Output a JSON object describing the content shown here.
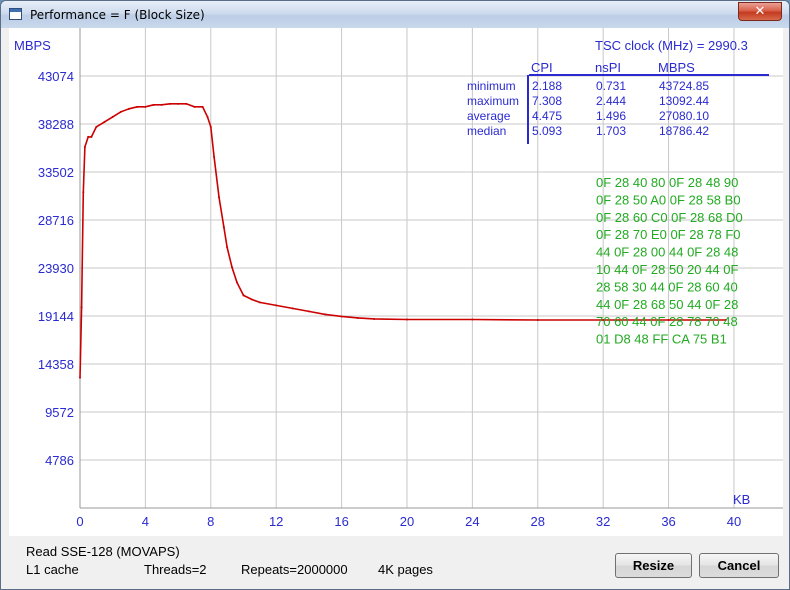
{
  "window": {
    "title": "Performance = F (Block Size)",
    "close_glyph": "✕"
  },
  "stats": {
    "tsc_label": "TSC clock (MHz)  = 2990.3",
    "headers": [
      "CPI",
      "nsPI",
      "MBPS"
    ],
    "rows": [
      {
        "label": "minimum",
        "cpi": "2.188",
        "nspi": "0.731",
        "mbps": "43724.85"
      },
      {
        "label": "maximum",
        "cpi": "7.308",
        "nspi": "2.444",
        "mbps": "13092.44"
      },
      {
        "label": "average",
        "cpi": "4.475",
        "nspi": "1.496",
        "mbps": "27080.10"
      },
      {
        "label": "median",
        "cpi": "5.093",
        "nspi": "1.703",
        "mbps": "18786.42"
      }
    ],
    "opcode_lines": [
      "0F  28  40  80  0F  28  48  90",
      "0F  28  50  A0  0F  28  58  B0",
      "0F  28  60  C0  0F  28  68  D0",
      "0F  28  70  E0  0F  28  78  F0",
      "44  0F  28  00  44  0F  28  48",
      "10  44  0F  28  50  20  44  0F",
      "28  58  30  44  0F  28  60  40",
      "44  0F  28  68  50  44  0F  28",
      "70  60  44  0F  28  78  70  48",
      "01  D8  48  FF  CA 75  B1"
    ]
  },
  "footer": {
    "line1": "Read SSE-128 (MOVAPS)",
    "cache": "L1 cache",
    "threads": "Threads=2",
    "repeats": "Repeats=2000000",
    "pages": "4K pages"
  },
  "buttons": {
    "resize": "Resize",
    "cancel": "Cancel"
  },
  "colors": {
    "series": "#cc0000",
    "axis_text": "#2a2ad0",
    "opcodes": "#22aa22",
    "grid": "#c8c8c8"
  },
  "chart_data": {
    "type": "line",
    "ylabel": "MBPS",
    "xlabel": "KB",
    "xlim": [
      0,
      43
    ],
    "ylim": [
      0,
      47860
    ],
    "x_ticks": [
      0,
      4,
      8,
      12,
      16,
      20,
      24,
      28,
      32,
      36,
      40
    ],
    "y_ticks": [
      4786,
      9572,
      14358,
      19144,
      23930,
      28716,
      33502,
      38288,
      43074
    ],
    "grid": true,
    "series": [
      {
        "x": [
          0.0,
          0.1,
          0.2,
          0.3,
          0.5,
          0.7,
          1.0,
          1.5,
          2.0,
          2.5,
          3.0,
          3.5,
          4.0,
          4.5,
          5.0,
          5.5,
          6.0,
          6.5,
          7.0,
          7.5,
          7.8,
          8.0,
          8.2,
          8.5,
          8.8,
          9.0,
          9.3,
          9.6,
          10.0,
          10.5,
          11.0,
          12.0,
          13.0,
          14.0,
          15.0,
          16.0,
          17.0,
          18.0,
          20.0,
          24.0,
          28.0,
          32.0,
          36.0,
          39.5
        ],
        "y": [
          13000,
          20000,
          31500,
          36000,
          37000,
          37000,
          38000,
          38500,
          39000,
          39500,
          39800,
          40000,
          40000,
          40200,
          40200,
          40300,
          40300,
          40300,
          40000,
          40000,
          39000,
          38000,
          35000,
          31000,
          28000,
          26000,
          24000,
          22500,
          21200,
          20800,
          20500,
          20200,
          19900,
          19600,
          19300,
          19100,
          18950,
          18850,
          18800,
          18800,
          18750,
          18750,
          18750,
          18750
        ]
      }
    ]
  }
}
